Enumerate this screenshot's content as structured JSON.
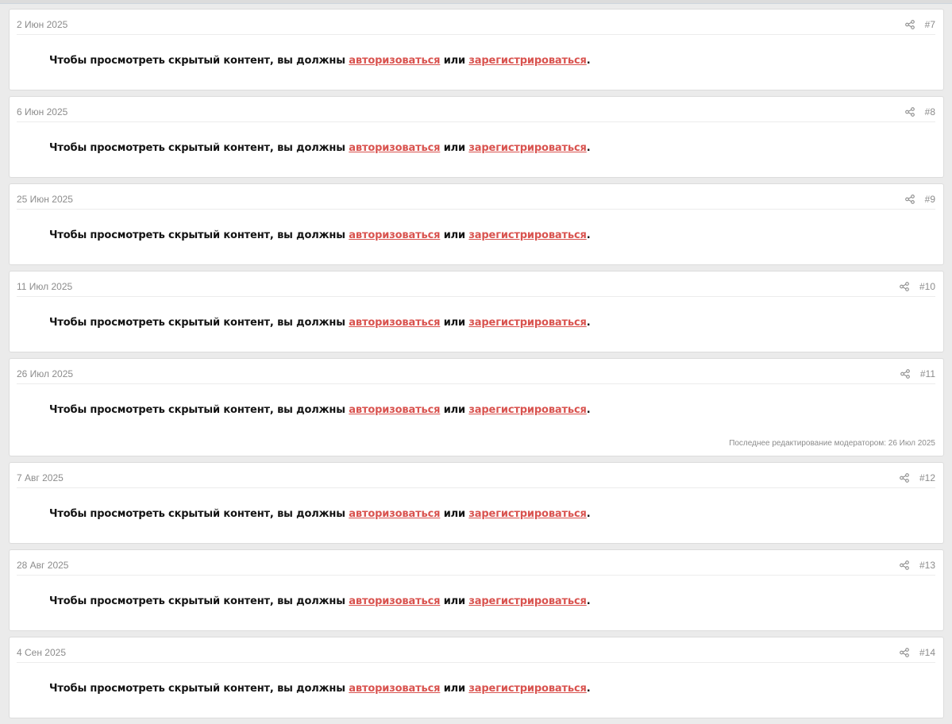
{
  "colors": {
    "page_background": "#ebebeb",
    "card_background": "#ffffff",
    "meta_text": "#8c8c8c",
    "body_text": "#141414",
    "link": "#d9534f"
  },
  "posts": [
    {
      "date": "2 Июн 2025",
      "number": "#7",
      "share_icon": "share-icon",
      "body": {
        "prefix": "Чтобы просмотреть скрытый контент, вы должны ",
        "login_link": "авторизоваться",
        "middle": " или ",
        "register_link": "зарегистрироваться",
        "suffix": "."
      }
    },
    {
      "date": "6 Июн 2025",
      "number": "#8",
      "share_icon": "share-icon",
      "body": {
        "prefix": "Чтобы просмотреть скрытый контент, вы должны ",
        "login_link": "авторизоваться",
        "middle": " или ",
        "register_link": "зарегистрироваться",
        "suffix": "."
      }
    },
    {
      "date": "25 Июн 2025",
      "number": "#9",
      "share_icon": "share-icon",
      "body": {
        "prefix": "Чтобы просмотреть скрытый контент, вы должны ",
        "login_link": "авторизоваться",
        "middle": " или ",
        "register_link": "зарегистрироваться",
        "suffix": "."
      }
    },
    {
      "date": "11 Июл 2025",
      "number": "#10",
      "share_icon": "share-icon",
      "body": {
        "prefix": "Чтобы просмотреть скрытый контент, вы должны ",
        "login_link": "авторизоваться",
        "middle": " или ",
        "register_link": "зарегистрироваться",
        "suffix": "."
      }
    },
    {
      "date": "26 Июл 2025",
      "number": "#11",
      "share_icon": "share-icon",
      "body": {
        "prefix": "Чтобы просмотреть скрытый контент, вы должны ",
        "login_link": "авторизоваться",
        "middle": " или ",
        "register_link": "зарегистрироваться",
        "suffix": "."
      },
      "edit_note": "Последнее редактирование модератором: 26 Июл 2025"
    },
    {
      "date": "7 Авг 2025",
      "number": "#12",
      "share_icon": "share-icon",
      "body": {
        "prefix": "Чтобы просмотреть скрытый контент, вы должны ",
        "login_link": "авторизоваться",
        "middle": " или ",
        "register_link": "зарегистрироваться",
        "suffix": "."
      }
    },
    {
      "date": "28 Авг 2025",
      "number": "#13",
      "share_icon": "share-icon",
      "body": {
        "prefix": "Чтобы просмотреть скрытый контент, вы должны ",
        "login_link": "авторизоваться",
        "middle": " или ",
        "register_link": "зарегистрироваться",
        "suffix": "."
      }
    },
    {
      "date": "4 Сен 2025",
      "number": "#14",
      "share_icon": "share-icon",
      "body": {
        "prefix": "Чтобы просмотреть скрытый контент, вы должны ",
        "login_link": "авторизоваться",
        "middle": " или ",
        "register_link": "зарегистрироваться",
        "suffix": "."
      }
    }
  ]
}
